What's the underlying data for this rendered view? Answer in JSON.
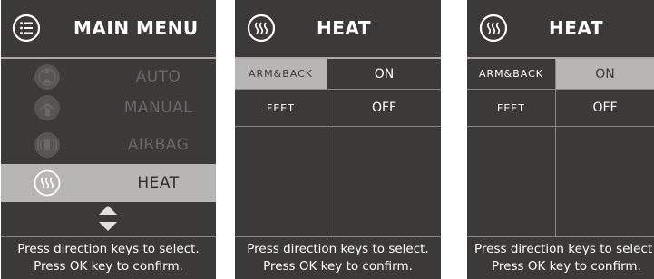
{
  "main_menu": {
    "title": "MAIN MENU",
    "icon": "list-icon",
    "items": [
      {
        "label": "AUTO",
        "icon": "auto-massage-icon",
        "state": "disabled"
      },
      {
        "label": "MANUAL",
        "icon": "manual-massage-icon",
        "state": "disabled"
      },
      {
        "label": "AIRBAG",
        "icon": "airbag-icon",
        "state": "disabled"
      },
      {
        "label": "HEAT",
        "icon": "heat-icon",
        "state": "selected"
      }
    ],
    "nav_icon": "up-down-arrows-icon",
    "footer": {
      "line1": "Press direction keys to select.",
      "line2": "Press OK key to confirm."
    }
  },
  "heat_screen_1": {
    "title": "HEAT",
    "icon": "heat-icon",
    "rows": [
      {
        "name": "ARM&BACK",
        "value": "ON",
        "highlight": "name"
      },
      {
        "name": "FEET",
        "value": "OFF",
        "highlight": "none"
      }
    ],
    "footer": {
      "line1": "Press direction keys to select.",
      "line2": "Press OK key to confirm."
    }
  },
  "heat_screen_2": {
    "title": "HEAT",
    "icon": "heat-icon",
    "rows": [
      {
        "name": "ARM&BACK",
        "value": "ON",
        "highlight": "value"
      },
      {
        "name": "FEET",
        "value": "OFF",
        "highlight": "none"
      }
    ],
    "footer": {
      "line1": "Press direction keys to select",
      "line2": "Press OK key to confirm."
    }
  },
  "colors": {
    "panel_bg": "#3c3a39",
    "highlight": "#b8b6b4",
    "text": "#ffffff",
    "disabled_text": "#6a6868"
  }
}
